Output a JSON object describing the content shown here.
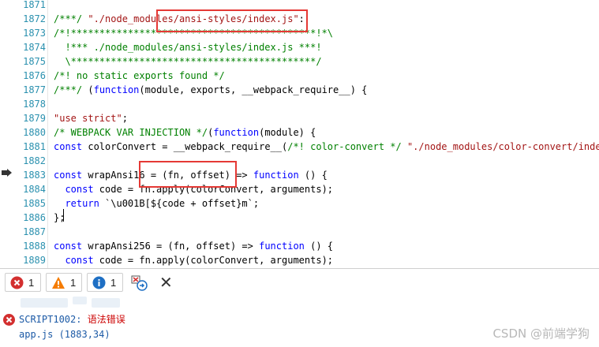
{
  "editor": {
    "lines": [
      {
        "n": "1871",
        "segs": []
      },
      {
        "n": "1872",
        "segs": [
          {
            "c": "cm",
            "t": "/***/ "
          },
          {
            "c": "str",
            "t": "\"./node_modules/ansi-styles/index.js\""
          },
          {
            "c": "",
            "t": ":"
          }
        ]
      },
      {
        "n": "1873",
        "segs": [
          {
            "c": "cm",
            "t": "/*!*******************************************!*\\"
          }
        ]
      },
      {
        "n": "1874",
        "segs": [
          {
            "c": "cm",
            "t": "  !*** ./node_modules/ansi-styles/index.js ***!"
          }
        ]
      },
      {
        "n": "1875",
        "segs": [
          {
            "c": "cm",
            "t": "  \\*******************************************/"
          }
        ]
      },
      {
        "n": "1876",
        "segs": [
          {
            "c": "cm",
            "t": "/*! no static exports found */"
          }
        ]
      },
      {
        "n": "1877",
        "segs": [
          {
            "c": "cm",
            "t": "/***/ "
          },
          {
            "c": "",
            "t": "("
          },
          {
            "c": "kw",
            "t": "function"
          },
          {
            "c": "",
            "t": "(module, exports, __webpack_require__) {"
          }
        ]
      },
      {
        "n": "1878",
        "segs": []
      },
      {
        "n": "1879",
        "segs": [
          {
            "c": "str",
            "t": "\"use strict\""
          },
          {
            "c": "",
            "t": ";"
          }
        ]
      },
      {
        "n": "1880",
        "segs": [
          {
            "c": "cm",
            "t": "/* WEBPACK VAR INJECTION */"
          },
          {
            "c": "",
            "t": "("
          },
          {
            "c": "kw",
            "t": "function"
          },
          {
            "c": "",
            "t": "(module) {"
          }
        ]
      },
      {
        "n": "1881",
        "segs": [
          {
            "c": "kw",
            "t": "const"
          },
          {
            "c": "",
            "t": " colorConvert = __webpack_require__("
          },
          {
            "c": "cm",
            "t": "/*! color-convert */"
          },
          {
            "c": "",
            "t": " "
          },
          {
            "c": "str",
            "t": "\"./node_modules/color-convert/index.js\""
          },
          {
            "c": "",
            "t": ");"
          }
        ]
      },
      {
        "n": "1882",
        "segs": []
      },
      {
        "n": "1883",
        "segs": [
          {
            "c": "kw",
            "t": "const"
          },
          {
            "c": "",
            "t": " wrapAnsi16 = (fn, offset) => "
          },
          {
            "c": "kw",
            "t": "function"
          },
          {
            "c": "",
            "t": " () {"
          }
        ]
      },
      {
        "n": "1884",
        "segs": [
          {
            "c": "",
            "t": "  "
          },
          {
            "c": "kw",
            "t": "const"
          },
          {
            "c": "",
            "t": " code = fn.apply(colorConvert, arguments);"
          }
        ]
      },
      {
        "n": "1885",
        "segs": [
          {
            "c": "",
            "t": "  "
          },
          {
            "c": "kw",
            "t": "return"
          },
          {
            "c": "",
            "t": " `\\u001B[${code + offset}m`;"
          }
        ]
      },
      {
        "n": "1886",
        "segs": [
          {
            "c": "",
            "t": "};"
          }
        ]
      },
      {
        "n": "1887",
        "segs": []
      },
      {
        "n": "1888",
        "segs": [
          {
            "c": "kw",
            "t": "const"
          },
          {
            "c": "",
            "t": " wrapAnsi256 = (fn, offset) => "
          },
          {
            "c": "kw",
            "t": "function"
          },
          {
            "c": "",
            "t": " () {"
          }
        ]
      },
      {
        "n": "1889",
        "segs": [
          {
            "c": "",
            "t": "  "
          },
          {
            "c": "kw",
            "t": "const"
          },
          {
            "c": "",
            "t": " code = fn.apply(colorConvert, arguments);"
          }
        ]
      }
    ]
  },
  "toolbar": {
    "errors_count": "1",
    "warnings_count": "1",
    "info_count": "1"
  },
  "console": {
    "error_code": "SCRIPT1002:",
    "error_text": "语法错误",
    "location": "app.js (1883,34)"
  },
  "watermark": "CSDN @前端学狗",
  "colors": {
    "highlight_box": "#e53935",
    "line_number": "#2b91af",
    "keyword": "#0000ff",
    "string": "#a31515",
    "comment": "#008000"
  }
}
